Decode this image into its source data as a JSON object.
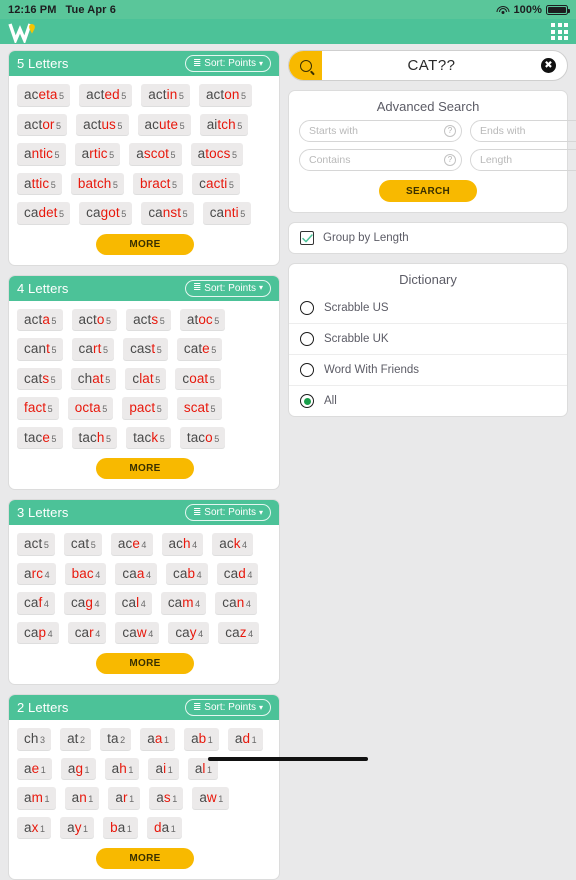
{
  "statusbar": {
    "time": "12:16 PM",
    "date": "Tue Apr 6",
    "battery": "100%",
    "wifi_icon": "wifi-icon",
    "battery_icon": "battery-icon"
  },
  "appbar": {
    "logo_icon": "w-logo-icon",
    "apps_icon": "grid-apps-icon",
    "bg_color": "#4cc298"
  },
  "search": {
    "value": "CAT??",
    "search_icon": "magnifier-icon",
    "clear_icon": "clear-circle-icon",
    "accent": "#f8b900"
  },
  "advanced": {
    "title": "Advanced Search",
    "fields": [
      {
        "name": "starts-with",
        "placeholder": "Starts with",
        "value": ""
      },
      {
        "name": "ends-with",
        "placeholder": "Ends with",
        "value": ""
      },
      {
        "name": "contains",
        "placeholder": "Contains",
        "value": ""
      },
      {
        "name": "length",
        "placeholder": "Length",
        "value": ""
      }
    ],
    "help_icon": "question-mark-icon",
    "button": "SEARCH"
  },
  "group_by_length": {
    "label": "Group by Length",
    "checked": true,
    "check_icon": "check-icon"
  },
  "dictionary": {
    "title": "Dictionary",
    "options": [
      {
        "label": "Scrabble US",
        "selected": false
      },
      {
        "label": "Scrabble UK",
        "selected": false
      },
      {
        "label": "Word With Friends",
        "selected": false
      },
      {
        "label": "All",
        "selected": true
      }
    ],
    "selected_color": "#1a9e4b"
  },
  "common": {
    "sort_label": "Sort: Points",
    "sort_icon": "sort-icon",
    "chevron_icon": "chevron-down-icon",
    "more_label": "MORE",
    "highlight_color": "#e8180c"
  },
  "groups": [
    {
      "title": "5 Letters",
      "more": "MORE",
      "words": [
        {
          "plain": "ac",
          "hl": "eta",
          "points": "5"
        },
        {
          "plain": "act",
          "hl": "ed",
          "points": "5"
        },
        {
          "plain": "act",
          "hl": "in",
          "points": "5"
        },
        {
          "plain": "act",
          "hl": "on",
          "points": "5"
        },
        {
          "plain": "act",
          "hl": "or",
          "points": "5"
        },
        {
          "plain": "act",
          "hl": "us",
          "points": "5"
        },
        {
          "plain": "ac",
          "hl": "ute",
          "points": "5"
        },
        {
          "plain": "ai",
          "hl": "tch",
          "points": "5"
        },
        {
          "plain": "a",
          "hl": "ntic",
          "points": "5"
        },
        {
          "plain": "a",
          "hl": "rtic",
          "points": "5"
        },
        {
          "plain": "a",
          "hl": "scot",
          "points": "5"
        },
        {
          "plain": "a",
          "hl": "tocs",
          "points": "5"
        },
        {
          "plain": "a",
          "hl": "ttic",
          "points": "5"
        },
        {
          "plain": "",
          "hl": "batch",
          "points": "5"
        },
        {
          "plain": "",
          "hl": "bract",
          "points": "5"
        },
        {
          "plain": "c",
          "hl": "acti",
          "points": "5"
        },
        {
          "plain": "ca",
          "hl": "det",
          "points": "5"
        },
        {
          "plain": "ca",
          "hl": "got",
          "points": "5"
        },
        {
          "plain": "ca",
          "hl": "nst",
          "points": "5"
        },
        {
          "plain": "ca",
          "hl": "nti",
          "points": "5"
        }
      ]
    },
    {
      "title": "4 Letters",
      "more": "MORE",
      "words": [
        {
          "plain": "act",
          "hl": "a",
          "points": "5"
        },
        {
          "plain": "act",
          "hl": "o",
          "points": "5"
        },
        {
          "plain": "act",
          "hl": "s",
          "points": "5"
        },
        {
          "plain": "at",
          "hl": "oc",
          "points": "5"
        },
        {
          "plain": "can",
          "hl": "t",
          "points": "5"
        },
        {
          "plain": "ca",
          "hl": "rt",
          "points": "5"
        },
        {
          "plain": "cas",
          "hl": "t",
          "points": "5"
        },
        {
          "plain": "cat",
          "hl": "e",
          "points": "5"
        },
        {
          "plain": "cat",
          "hl": "s",
          "points": "5"
        },
        {
          "plain": "ch",
          "hl": "at",
          "points": "5"
        },
        {
          "plain": "c",
          "hl": "lat",
          "points": "5"
        },
        {
          "plain": "c",
          "hl": "oat",
          "points": "5"
        },
        {
          "plain": "",
          "hl": "fact",
          "points": "5"
        },
        {
          "plain": "",
          "hl": "octa",
          "points": "5"
        },
        {
          "plain": "",
          "hl": "pact",
          "points": "5"
        },
        {
          "plain": "",
          "hl": "scat",
          "points": "5"
        },
        {
          "plain": "tac",
          "hl": "e",
          "points": "5"
        },
        {
          "plain": "tac",
          "hl": "h",
          "points": "5"
        },
        {
          "plain": "tac",
          "hl": "k",
          "points": "5"
        },
        {
          "plain": "tac",
          "hl": "o",
          "points": "5"
        }
      ]
    },
    {
      "title": "3 Letters",
      "more": "MORE",
      "words": [
        {
          "plain": "act",
          "hl": "",
          "points": "5"
        },
        {
          "plain": "cat",
          "hl": "",
          "points": "5"
        },
        {
          "plain": "ac",
          "hl": "e",
          "points": "4"
        },
        {
          "plain": "ac",
          "hl": "h",
          "points": "4"
        },
        {
          "plain": "ac",
          "hl": "k",
          "points": "4"
        },
        {
          "plain": "a",
          "hl": "rc",
          "points": "4"
        },
        {
          "plain": "",
          "hl": "bac",
          "points": "4"
        },
        {
          "plain": "ca",
          "hl": "a",
          "points": "4"
        },
        {
          "plain": "ca",
          "hl": "b",
          "points": "4"
        },
        {
          "plain": "ca",
          "hl": "d",
          "points": "4"
        },
        {
          "plain": "ca",
          "hl": "f",
          "points": "4"
        },
        {
          "plain": "ca",
          "hl": "g",
          "points": "4"
        },
        {
          "plain": "ca",
          "hl": "l",
          "points": "4"
        },
        {
          "plain": "ca",
          "hl": "m",
          "points": "4"
        },
        {
          "plain": "ca",
          "hl": "n",
          "points": "4"
        },
        {
          "plain": "ca",
          "hl": "p",
          "points": "4"
        },
        {
          "plain": "ca",
          "hl": "r",
          "points": "4"
        },
        {
          "plain": "ca",
          "hl": "w",
          "points": "4"
        },
        {
          "plain": "ca",
          "hl": "y",
          "points": "4"
        },
        {
          "plain": "ca",
          "hl": "z",
          "points": "4"
        }
      ]
    },
    {
      "title": "2 Letters",
      "more": "MORE",
      "words": [
        {
          "plain": "ch",
          "hl": "",
          "points": "3"
        },
        {
          "plain": "at",
          "hl": "",
          "points": "2"
        },
        {
          "plain": "ta",
          "hl": "",
          "points": "2"
        },
        {
          "plain": "a",
          "hl": "a",
          "points": "1"
        },
        {
          "plain": "a",
          "hl": "b",
          "points": "1"
        },
        {
          "plain": "a",
          "hl": "d",
          "points": "1"
        },
        {
          "plain": "a",
          "hl": "e",
          "points": "1"
        },
        {
          "plain": "a",
          "hl": "g",
          "points": "1"
        },
        {
          "plain": "a",
          "hl": "h",
          "points": "1"
        },
        {
          "plain": "a",
          "hl": "i",
          "points": "1"
        },
        {
          "plain": "a",
          "hl": "l",
          "points": "1"
        },
        {
          "plain": "a",
          "hl": "m",
          "points": "1"
        },
        {
          "plain": "a",
          "hl": "n",
          "points": "1"
        },
        {
          "plain": "a",
          "hl": "r",
          "points": "1"
        },
        {
          "plain": "a",
          "hl": "s",
          "points": "1"
        },
        {
          "plain": "a",
          "hl": "w",
          "points": "1"
        },
        {
          "plain": "a",
          "hl": "x",
          "points": "1"
        },
        {
          "plain": "a",
          "hl": "y",
          "points": "1"
        },
        {
          "plain": "",
          "hl": "b",
          "points": "1",
          "suffix": "a"
        },
        {
          "plain": "",
          "hl": "d",
          "points": "1",
          "suffix": "a"
        }
      ]
    }
  ]
}
